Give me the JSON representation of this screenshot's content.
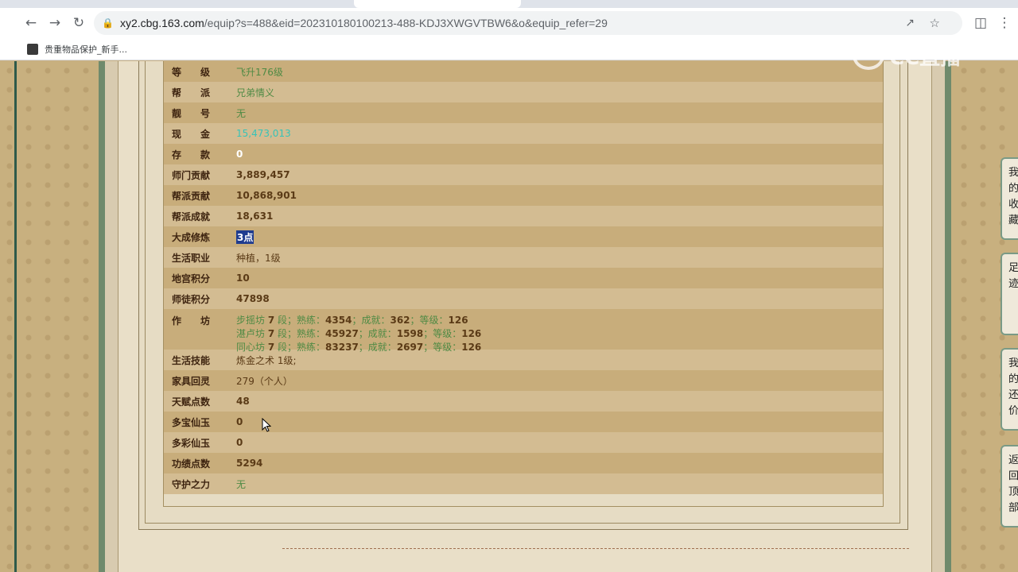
{
  "browser": {
    "url_host": "xy2.cbg.163.com",
    "url_path": "/equip?s=488&eid=202310180100213-488-KDJ3XWGVTBW6&o&equip_refer=29",
    "bookmark_label": "贵重物品保护_新手..."
  },
  "watermark": {
    "text": "CC直播"
  },
  "info_rows": [
    {
      "label": "等　　级",
      "value": "飞升176级"
    },
    {
      "label": "帮　　派",
      "value": "兄弟情义"
    },
    {
      "label": "靓　　号",
      "value": "无"
    },
    {
      "label": "现　　金",
      "value": "15,473,013"
    },
    {
      "label": "存　　款",
      "value": "0"
    },
    {
      "label": "师门贡献",
      "value": "3,889,457"
    },
    {
      "label": "帮派贡献",
      "value": "10,868,901"
    },
    {
      "label": "帮派成就",
      "value": "18,631"
    },
    {
      "label": "大成修炼",
      "value": "3点"
    },
    {
      "label": "生活职业",
      "value": "种植，1级"
    },
    {
      "label": "地宫积分",
      "value": "10"
    },
    {
      "label": "师徒积分",
      "value": "47898"
    },
    {
      "label": "作　　坊",
      "value": ""
    },
    {
      "label": "生活技能",
      "value": "炼金之术 1级;"
    },
    {
      "label": "家具回灵",
      "value": "279（个人）"
    },
    {
      "label": "天赋点数",
      "value": "48"
    },
    {
      "label": "多宝仙玉",
      "value": "0"
    },
    {
      "label": "多彩仙玉",
      "value": "0"
    },
    {
      "label": "功绩点数",
      "value": "5294"
    },
    {
      "label": "守护之力",
      "value": "无"
    }
  ],
  "workshops": [
    {
      "name": "步摇坊",
      "level": "7",
      "seg": "段；熟练：",
      "skill": "4354",
      "ach_label": "；成就：",
      "ach": "362",
      "grade_label": "；等级：",
      "grade": "126"
    },
    {
      "name": "湛卢坊",
      "level": "7",
      "seg": "段；熟练：",
      "skill": "45927",
      "ach_label": "；成就：",
      "ach": "1598",
      "grade_label": "；等级：",
      "grade": "126"
    },
    {
      "name": "同心坊",
      "level": "7",
      "seg": "段；熟练：",
      "skill": "83237",
      "ach_label": "；成就：",
      "ach": "2697",
      "grade_label": "；等级：",
      "grade": "126"
    }
  ],
  "side_buttons": [
    {
      "text": "我的收藏"
    },
    {
      "text": "足迹"
    },
    {
      "text": "我的还价"
    },
    {
      "text": "返回顶部"
    }
  ],
  "colors": {
    "green_text": "#4f8a44",
    "cash_text": "#36c3b8",
    "highlight": "#1f3c8f"
  }
}
